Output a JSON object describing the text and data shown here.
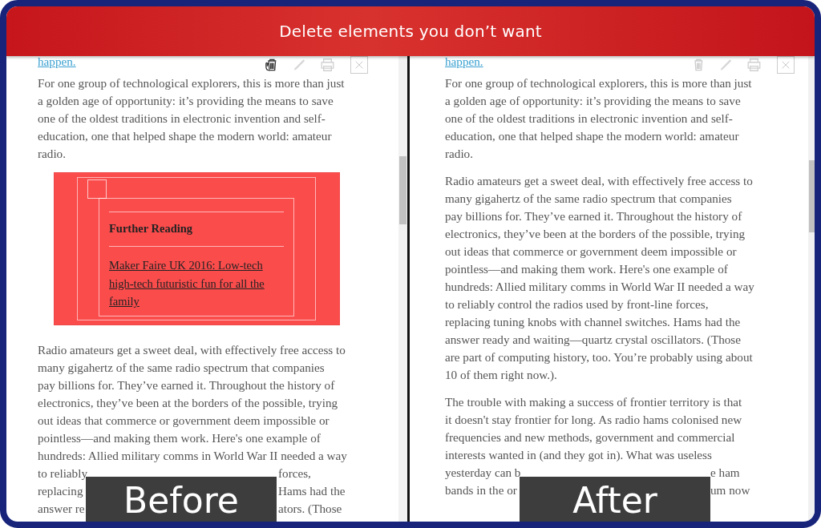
{
  "header": {
    "title": "Delete elements you don’t want"
  },
  "panels": [
    {
      "label": "Before",
      "cursor_on_delete": true,
      "blocks": [
        {
          "kind": "link_line",
          "text": "happen."
        },
        {
          "kind": "paragraph",
          "lines": [
            "For one group of technological explorers, this is more than just",
            "a golden age of opportunity: it’s providing the means to save",
            "one of the oldest traditions in electronic invention and self-",
            "education, one that helped shape the modern world: amateur",
            "radio."
          ]
        },
        {
          "kind": "callout",
          "highlighted": true,
          "heading": "Further Reading",
          "link_lines": [
            "Maker Faire UK 2016: Low-tech",
            "high-tech futuristic fun for all the",
            "family"
          ]
        },
        {
          "kind": "paragraph",
          "lines": [
            "Radio amateurs get a sweet deal, with effectively free access to",
            "many gigahertz of the same radio spectrum that companies",
            "pay billions for. They’ve earned it. Throughout the history of",
            "electronics, they’ve been at the borders of the possible, trying",
            "out ideas that commerce or government deem impossible or",
            "pointless—and making them work. Here's one example of",
            "hundreds: Allied military comms in World War II needed a way",
            [
              "to reliably",
              "forces,"
            ],
            [
              "replacing",
              "Hams had the"
            ],
            [
              "answer re",
              "ators. (Those"
            ]
          ]
        }
      ]
    },
    {
      "label": "After",
      "cursor_on_delete": false,
      "blocks": [
        {
          "kind": "link_line",
          "text": "happen."
        },
        {
          "kind": "paragraph",
          "lines": [
            "For one group of technological explorers, this is more than just",
            "a golden age of opportunity: it’s providing the means to save",
            "one of the oldest traditions in electronic invention and self-",
            "education, one that helped shape the modern world: amateur",
            "radio."
          ]
        },
        {
          "kind": "paragraph",
          "lines": [
            "Radio amateurs get a sweet deal, with effectively free access to",
            "many gigahertz of the same radio spectrum that companies",
            "pay billions for. They’ve earned it. Throughout the history of",
            "electronics, they’ve been at the borders of the possible, trying",
            "out ideas that commerce or government deem impossible or",
            "pointless—and making them work. Here's one example of",
            "hundreds: Allied military comms in World War II needed a way",
            "to reliably control the radios used by front-line forces,",
            "replacing tuning knobs with channel switches. Hams had the",
            "answer ready and waiting—quartz crystal oscillators. (Those",
            "are part of computing history, too. You’re probably using about",
            "10 of them right now.)."
          ]
        },
        {
          "kind": "paragraph",
          "lines": [
            "The trouble with making a success of frontier territory is that",
            "it doesn't stay frontier for long. As radio hams colonised new",
            "frequencies and new methods, government and commercial",
            "interests wanted in (and they got in). What was useless",
            [
              "yesterday can b",
              "e ham"
            ],
            [
              "bands in the or",
              "um now"
            ]
          ]
        }
      ]
    }
  ]
}
